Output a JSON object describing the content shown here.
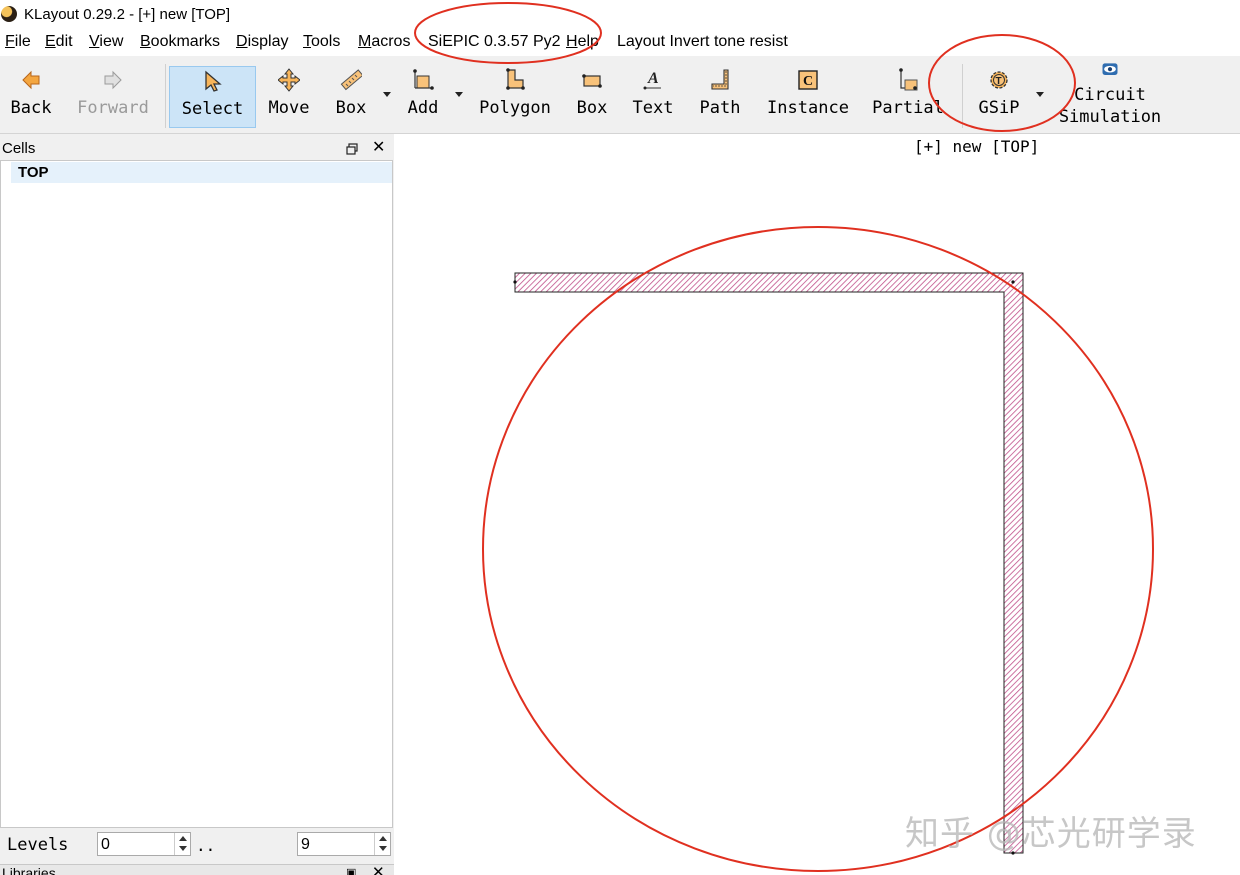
{
  "window": {
    "title": "KLayout 0.29.2 - [+] new [TOP]"
  },
  "menu": {
    "items": [
      {
        "label": "File",
        "mnemonic": "F"
      },
      {
        "label": "Edit",
        "mnemonic": "E"
      },
      {
        "label": "View",
        "mnemonic": "V"
      },
      {
        "label": "Bookmarks",
        "mnemonic": "B"
      },
      {
        "label": "Display",
        "mnemonic": "D"
      },
      {
        "label": "Tools",
        "mnemonic": "T"
      },
      {
        "label": "Macros",
        "mnemonic": "M"
      },
      {
        "label": "SiEPIC 0.3.57 Py2",
        "mnemonic": ""
      },
      {
        "label": "Help",
        "mnemonic": "H"
      },
      {
        "label": "Layout Invert tone resist",
        "mnemonic": ""
      }
    ]
  },
  "toolbar": {
    "back": "Back",
    "forward": "Forward",
    "select": "Select",
    "move": "Move",
    "box_ruler": "Box",
    "add": "Add",
    "polygon": "Polygon",
    "box": "Box",
    "text": "Text",
    "path": "Path",
    "instance": "Instance",
    "partial": "Partial",
    "gsip": "GSiP",
    "circuit_line1": "Circuit",
    "circuit_line2": "Simulation",
    "icons": {
      "back": "arrow-left-icon",
      "forward": "arrow-right-icon",
      "select": "cursor-arrow-icon",
      "move": "move-cross-icon",
      "box_ruler": "ruler-icon",
      "add": "add-points-icon",
      "polygon": "polygon-icon",
      "box": "box-icon",
      "text": "text-a-icon",
      "path": "path-icon",
      "instance": "instance-c-icon",
      "partial": "partial-edit-icon",
      "gsip": "gear-t-icon",
      "circuit": "eye-icon"
    }
  },
  "cells": {
    "title": "Cells",
    "items": [
      {
        "label": "TOP",
        "selected": true
      }
    ]
  },
  "levels": {
    "label": "Levels",
    "min": "0",
    "separator": "..",
    "max": "9"
  },
  "libraries": {
    "title": "Libraries"
  },
  "canvas": {
    "title": "[+] new [TOP]"
  },
  "colors": {
    "accent_select": "#cce4f7",
    "layer_stripe": "#c0508a",
    "annotation_red": "#e03020"
  },
  "watermark": {
    "text": "知乎 @芯光研学录"
  }
}
